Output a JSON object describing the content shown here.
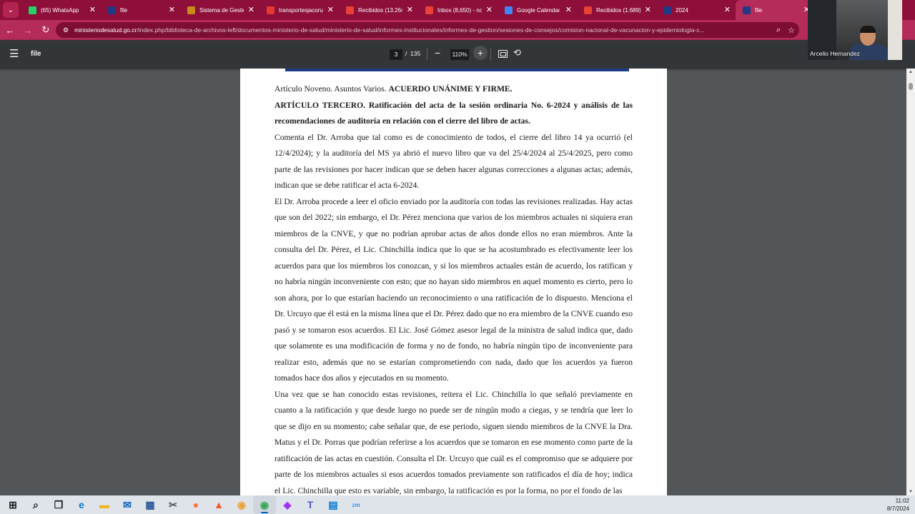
{
  "browser": {
    "tabs": [
      {
        "title": "(65) WhatsApp",
        "icon": "whatsapp-icon",
        "color": "#25d366",
        "active": false
      },
      {
        "title": "file",
        "icon": "ministry-favicon-icon",
        "color": "#1f3b84",
        "active": false
      },
      {
        "title": "Sistema de Gestión",
        "icon": "pencil-icon",
        "color": "#c98a1a",
        "active": false
      },
      {
        "title": "transportesjacoru",
        "icon": "letter-a-icon",
        "color": "#e53935",
        "active": false
      },
      {
        "title": "Recibidos (13.264)",
        "icon": "gmail-icon",
        "color": "#ea4335",
        "active": false
      },
      {
        "title": "Inbox (8,650) - nc",
        "icon": "gmail-icon",
        "color": "#ea4335",
        "active": false
      },
      {
        "title": "Google Calendar",
        "icon": "calendar-icon",
        "color": "#4285f4",
        "active": false
      },
      {
        "title": "Recibidos (1.689)",
        "icon": "gmail-icon",
        "color": "#ea4335",
        "active": false
      },
      {
        "title": "2024",
        "icon": "ministry-favicon-icon",
        "color": "#1f3b84",
        "active": false
      },
      {
        "title": "file",
        "icon": "ministry-favicon-icon",
        "color": "#1f3b84",
        "active": true
      }
    ],
    "close_glyph": "✕",
    "url_host": "ministeriodesalud.go.cr",
    "url_path": "/index.php/biblioteca-de-archivos-left/documentos-ministerio-de-salud/ministerio-de-salud/informes-institucionales/informes-de-gestion/sesiones-de-consejos/comision-nacional-de-vacunacion-y-epidemiologia-c..."
  },
  "pdf_viewer": {
    "title": "file",
    "current_page": "3",
    "page_separator": "/",
    "total_pages": "135",
    "zoom": "110%"
  },
  "webcam": {
    "participant_name": "Arcelio Hernandez"
  },
  "document": {
    "paragraphs": [
      {
        "plain": "Artículo Noveno. Asuntos Varios. ",
        "bold": "ACUERDO UNÁNIME Y FIRME."
      },
      {
        "plain": "",
        "bold": "ARTÍCULO TERCERO. Ratificación del acta de la sesión ordinaria No. 6-2024 y análisis de las recomendaciones de auditoría en relación con el cierre del libro de actas."
      },
      {
        "plain": "Comenta el Dr. Arroba que tal como es de conocimiento de todos, el cierre del libro 14 ya ocurrió (el 12/4/2024); y la auditoría del MS ya abrió el nuevo libro que va del 25/4/2024 al 25/4/2025, pero como parte de las revisiones por hacer indican que se deben hacer algunas correcciones a algunas actas; además, indican que se debe ratificar el acta 6-2024.",
        "bold": ""
      },
      {
        "plain": "El Dr. Arroba procede a leer el oficio enviado por la auditoría con todas las revisiones realizadas. Hay actas que son del 2022; sin embargo, el Dr. Pérez menciona que varios de los miembros actuales ni siquiera eran miembros de la CNVE, y que no podrían aprobar actas de años donde ellos no eran miembros. Ante la consulta del Dr. Pérez, el Lic. Chinchilla indica que lo que se ha acostumbrado es efectivamente leer los acuerdos para que los miembros los conozcan, y si los miembros actuales están de acuerdo, los ratifican y no habría ningún inconveniente con esto; que no hayan sido miembros en aquel momento es cierto, pero lo son ahora, por lo que estarían haciendo un reconocimiento o una ratificación de lo dispuesto. Menciona el Dr. Urcuyo que él está en la misma línea que el Dr. Pérez dado que no era miembro de la CNVE cuando eso pasó y se tomaron esos acuerdos. El Lic.  José Gómez asesor legal de la ministra de salud indica que, dado que solamente es una modificación de forma y no de fondo, no habría ningún tipo de inconveniente para realizar esto, además que no se estarían comprometiendo con nada, dado que los acuerdos ya fueron tomados hace dos años y ejecutados en su momento.",
        "bold": ""
      },
      {
        "plain": "Una vez que se han conocido estas revisiones, reitera el Lic. Chinchilla lo que señaló previamente en cuanto a la ratificación y que desde luego no puede ser de ningún modo a ciegas, y se tendría que leer lo que se dijo en su momento; cabe señalar que, de ese periodo, siguen siendo miembros de la CNVE la Dra. Matus y el Dr. Porras que podrían referirse a los acuerdos que se tomaron en ese momento como parte de la ratificación de las actas en cuestión. Consulta el Dr. Urcuyo que cuál es el compromiso que se adquiere por parte de los miembros actuales si esos acuerdos tomados previamente son ratificados el día de hoy; indica el Lic. Chinchilla que esto es variable, sin embargo, la ratificación es por la forma, no por el fondo de las",
        "bold": ""
      }
    ]
  },
  "taskbar": {
    "apps": [
      {
        "name": "windows-start-icon",
        "glyph": "⊞",
        "color": "#1a1a1a"
      },
      {
        "name": "search-icon",
        "glyph": "⌕",
        "color": "#1a1a1a"
      },
      {
        "name": "task-view-icon",
        "glyph": "❐",
        "color": "#1a1a1a"
      },
      {
        "name": "edge-icon",
        "glyph": "e",
        "color": "#0c7ad4"
      },
      {
        "name": "file-explorer-icon",
        "glyph": "▬",
        "color": "#f2b422"
      },
      {
        "name": "mail-icon",
        "glyph": "✉",
        "color": "#0a64c2"
      },
      {
        "name": "calculator-icon",
        "glyph": "▦",
        "color": "#2b5797"
      },
      {
        "name": "snipping-tool-icon",
        "glyph": "✂",
        "color": "#505050"
      },
      {
        "name": "firefox-icon",
        "glyph": "●",
        "color": "#ff7139"
      },
      {
        "name": "brave-icon",
        "glyph": "▲",
        "color": "#fb542b"
      },
      {
        "name": "chromium-icon",
        "glyph": "◉",
        "color": "#e8a33d"
      },
      {
        "name": "chrome-icon",
        "glyph": "◉",
        "color": "#34a853"
      },
      {
        "name": "messenger-icon",
        "glyph": "◆",
        "color": "#a033ff"
      },
      {
        "name": "teams-icon",
        "glyph": "T",
        "color": "#5059c9"
      },
      {
        "name": "notes-icon",
        "glyph": "▤",
        "color": "#0078d4"
      },
      {
        "name": "zoom-icon",
        "glyph": "zm",
        "color": "#2d8cff"
      }
    ],
    "time": "11:02",
    "date": "8/7/2024"
  }
}
